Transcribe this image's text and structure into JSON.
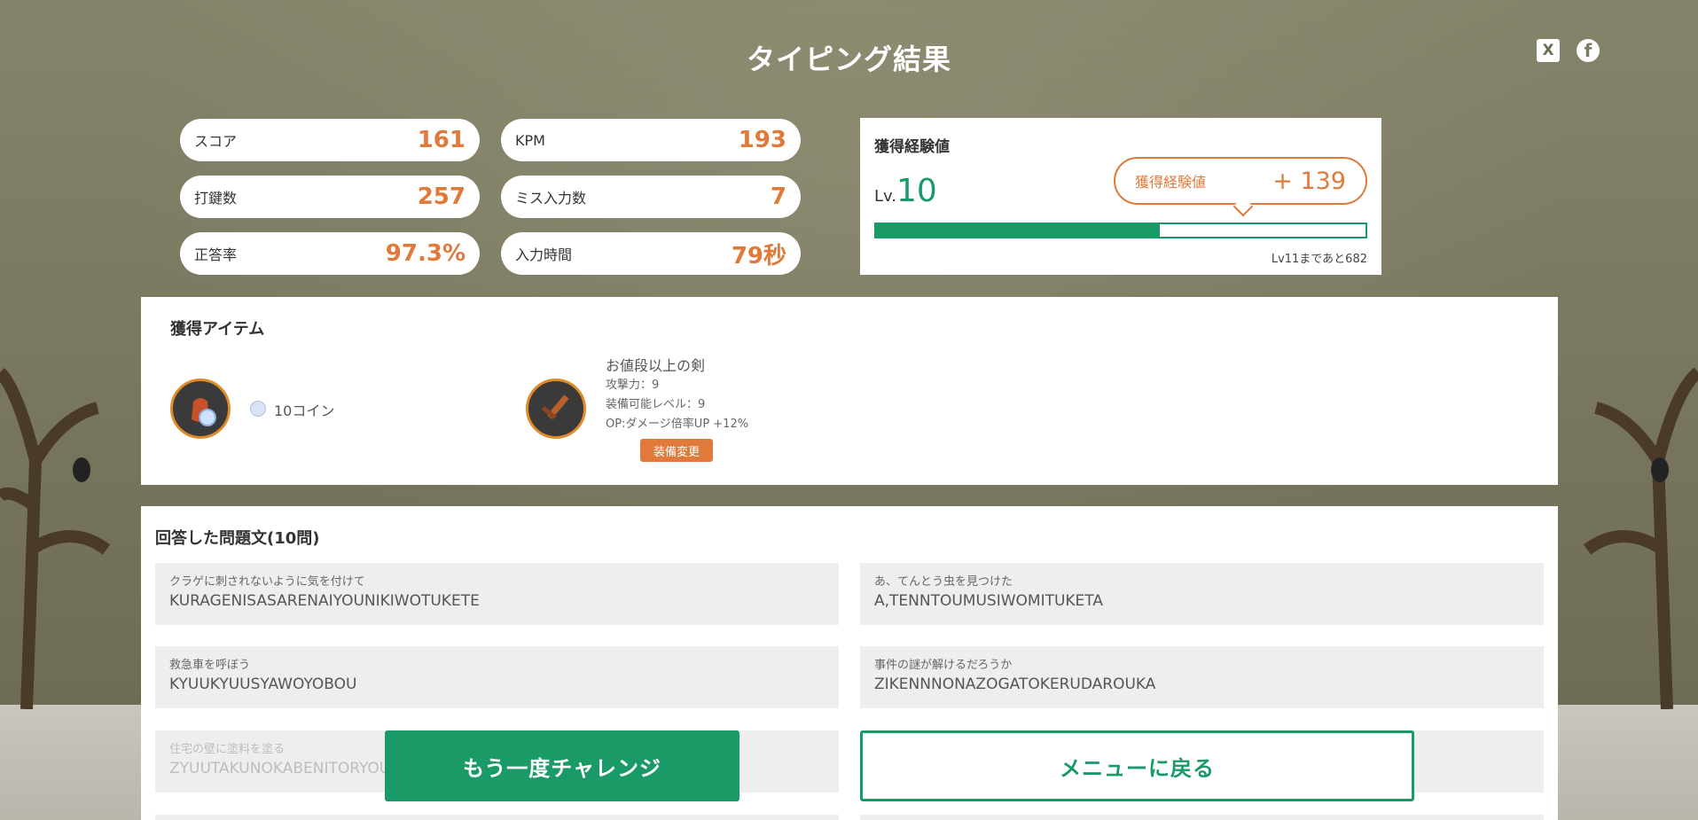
{
  "page": {
    "title": "タイピング結果"
  },
  "social": {
    "x_label": "X",
    "facebook_label": "f"
  },
  "stats": [
    {
      "label": "スコア",
      "value": "161"
    },
    {
      "label": "KPM",
      "value": "193"
    },
    {
      "label": "打鍵数",
      "value": "257"
    },
    {
      "label": "ミス入力数",
      "value": "7"
    },
    {
      "label": "正答率",
      "value": "97.3%"
    },
    {
      "label": "入力時間",
      "value": "79秒"
    }
  ],
  "experience": {
    "title": "獲得経験値",
    "level_prefix": "Lv.",
    "level": "10",
    "gained_label": "獲得経験値",
    "gained_value": "+ 139",
    "progress_fraction": 0.58,
    "next_level_text": "Lv11まであと682",
    "bar_color": "#1a9a67"
  },
  "items": {
    "title": "獲得アイテム",
    "coin": {
      "icon": "coin-bag-icon",
      "label": "10コイン"
    },
    "weapon": {
      "icon": "sword-icon",
      "name": "お値段以上の剣",
      "attack": "攻撃力：9",
      "equip_level": "装備可能レベル：9",
      "option": "OP:ダメージ倍率UP +12%",
      "equip_button": "装備変更"
    }
  },
  "answers": {
    "title": "回答した問題文(10問)",
    "list": [
      {
        "japanese": "クラゲに刺されないように気を付けて",
        "romaji": "KURAGENISASARENAIYOUNIKIWOTUKETE"
      },
      {
        "japanese": "あ、てんとう虫を見つけた",
        "romaji": "A,TENNTOUMUSIWOMITUKETA"
      },
      {
        "japanese": "救急車を呼ぼう",
        "romaji": "KYUUKYUUSYAWOYOBOU"
      },
      {
        "japanese": "事件の謎が解けるだろうか",
        "romaji": "ZIKENNNONAZOGATOKERUDAROUKA"
      },
      {
        "japanese": "住宅の壁に塗料を塗る",
        "romaji": "ZYUUTAKUNOKABENITORYOU"
      }
    ]
  },
  "buttons": {
    "retry": "もう一度チャレンジ",
    "menu": "メニューに戻る"
  },
  "colors": {
    "accent_green": "#1a9a67",
    "accent_orange": "#e07a3a"
  }
}
